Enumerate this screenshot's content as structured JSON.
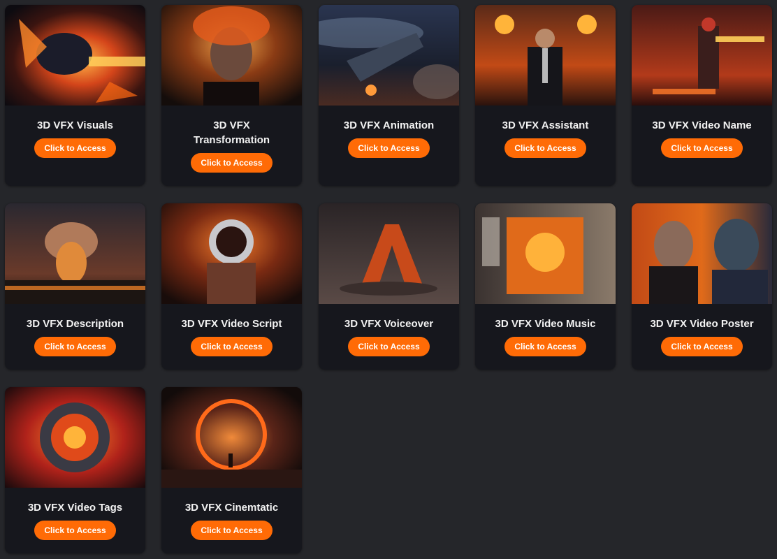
{
  "cards": [
    {
      "title": "3D VFX Visuals",
      "button_label": "Click to Access",
      "image": "fiery-creature-explosion"
    },
    {
      "title": "3D VFX Transformation",
      "button_label": "Click to Access",
      "image": "woman-with-fire-hair"
    },
    {
      "title": "3D VFX Animation",
      "button_label": "Click to Access",
      "image": "spaceship-in-space"
    },
    {
      "title": "3D VFX Assistant",
      "button_label": "Click to Access",
      "image": "man-with-flaming-fists"
    },
    {
      "title": "3D VFX Video Name",
      "button_label": "Click to Access",
      "image": "soldier-with-flamethrower"
    },
    {
      "title": "3D VFX Description",
      "button_label": "Click to Access",
      "image": "explosion-mushroom-cloud"
    },
    {
      "title": "3D VFX Video Script",
      "button_label": "Click to Access",
      "image": "astronaut-in-fire"
    },
    {
      "title": "3D VFX Voiceover",
      "button_label": "Click to Access",
      "image": "burning-letter-a"
    },
    {
      "title": "3D VFX Video Music",
      "button_label": "Click to Access",
      "image": "fire-screen-in-room"
    },
    {
      "title": "3D VFX Video Poster",
      "button_label": "Click to Access",
      "image": "man-facing-robot"
    },
    {
      "title": "3D VFX Video Tags",
      "button_label": "Click to Access",
      "image": "exploding-mechanical-sphere"
    },
    {
      "title": "3D VFX Cinemtatic",
      "button_label": "Click to Access",
      "image": "fiery-portal-ring"
    }
  ],
  "colors": {
    "page_background": "#25262a",
    "card_background": "#16171d",
    "button": "#ff6b06",
    "title_text": "#f2f2f2"
  }
}
